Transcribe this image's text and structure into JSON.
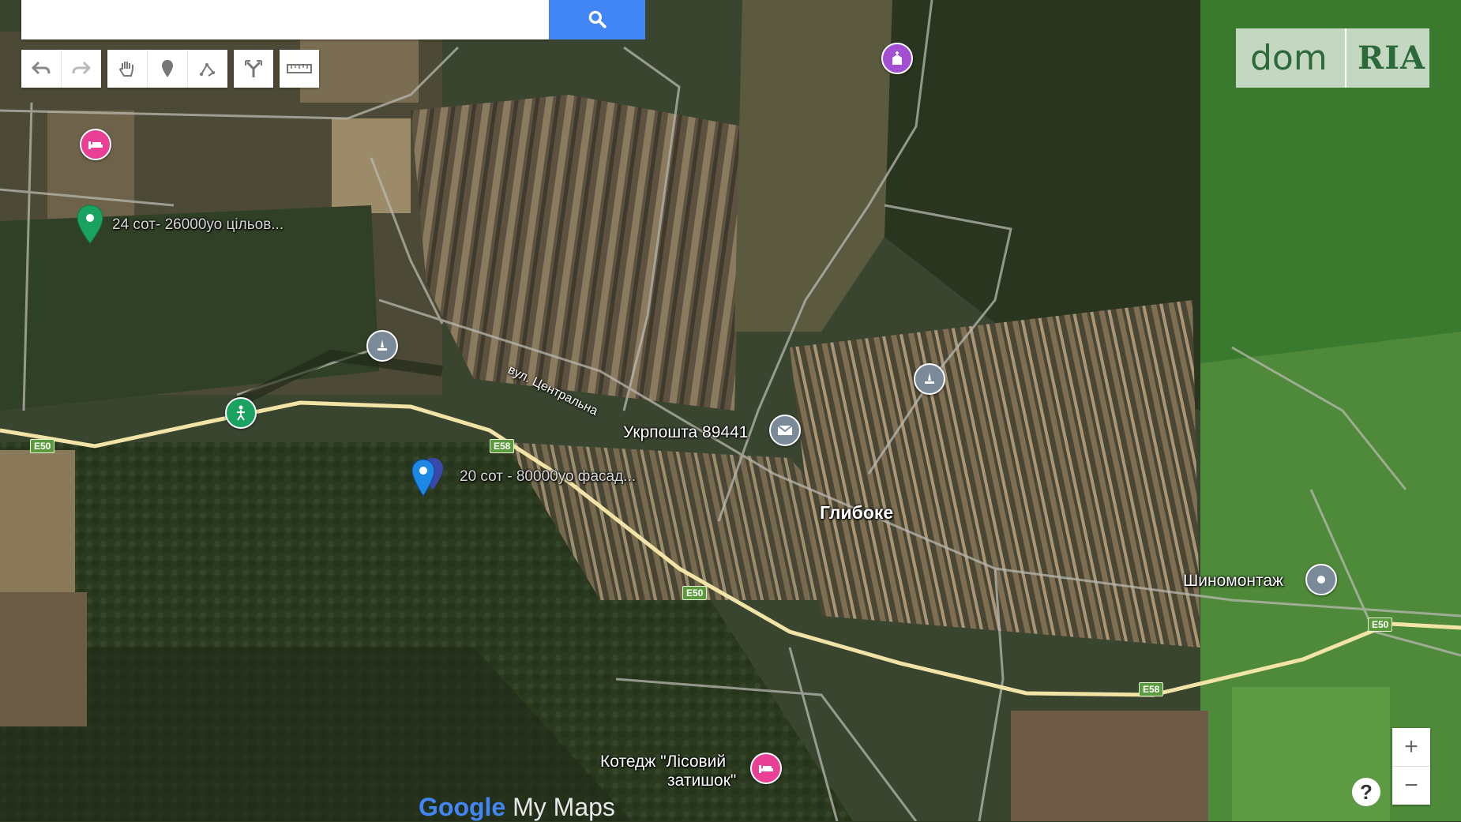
{
  "search": {
    "placeholder": "",
    "value": ""
  },
  "toolbar": {
    "undo": "undo-icon",
    "redo": "redo-icon",
    "pan": "hand-icon",
    "marker": "marker-icon",
    "line": "draw-line-icon",
    "directions": "directions-icon",
    "ruler": "ruler-icon"
  },
  "logo": {
    "left": "dom",
    "right": "RIA"
  },
  "labels": {
    "listing_24": "24 сот- 26000уо цільов...",
    "listing_20": "20 сот - 80000уо фасад...",
    "street": "вул. Центральна",
    "post": "Укрпошта 89441",
    "village": "Глибоке",
    "tire": "Шиномонтаж",
    "cottage_line1": "Котедж \"Лісовий",
    "cottage_line2": "затишок\""
  },
  "roads": {
    "e50": "E50",
    "e58": "E58"
  },
  "attribution": {
    "google": "Google",
    "mymaps": " My Maps"
  },
  "zoom": {
    "in": "+",
    "out": "−"
  },
  "help": "?",
  "colors": {
    "accent": "#4285f4",
    "road": "#f2e3a6",
    "pin_green": "#1aa260",
    "pin_blue": "#1976d2",
    "poi_pink": "#e94096",
    "poi_grey": "#7a8a99"
  }
}
